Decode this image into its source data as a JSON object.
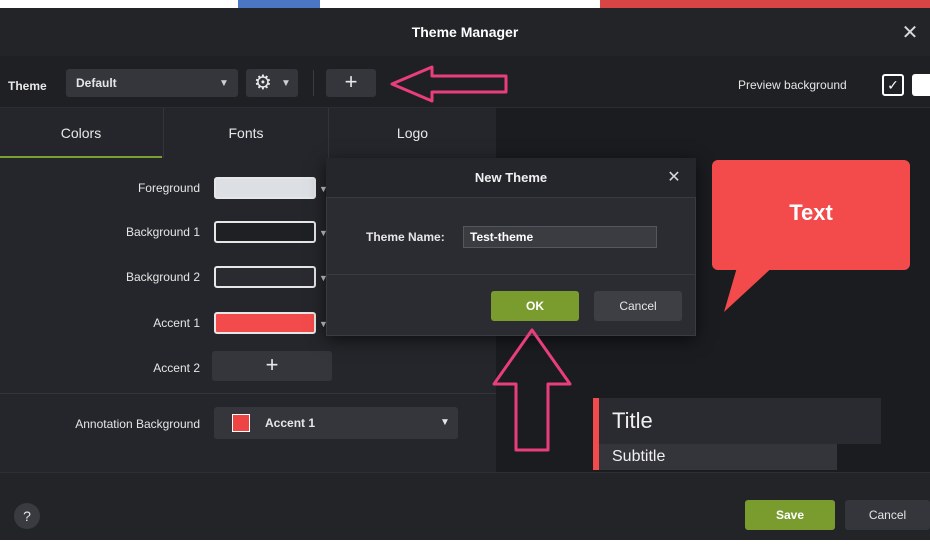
{
  "window": {
    "title": "Theme Manager",
    "close_glyph": "✕"
  },
  "toolbar": {
    "theme_label": "Theme",
    "theme_value": "Default",
    "caret_glyph": "▼",
    "gear_glyph": "⚙",
    "add_glyph": "+",
    "preview_background_label": "Preview background",
    "preview_checked_glyph": "✓"
  },
  "tabs": [
    {
      "label": "Colors",
      "active": true
    },
    {
      "label": "Fonts",
      "active": false
    },
    {
      "label": "Logo",
      "active": false
    }
  ],
  "colors": {
    "rows": [
      {
        "label": "Foreground",
        "color": "#dcdfe4"
      },
      {
        "label": "Background 1",
        "color": "#1f2024"
      },
      {
        "label": "Background 2",
        "color": "#2a2b30"
      },
      {
        "label": "Accent 1",
        "color": "#f34b4b"
      }
    ],
    "accent2_label": "Accent 2",
    "accent2_add_glyph": "+",
    "annotation_background_label": "Annotation Background",
    "annotation_background_value": "Accent 1",
    "annotation_background_color": "#ef4444"
  },
  "preview": {
    "callout_text": "Text",
    "callout_color": "#f34b4b",
    "lower_third_title": "Title",
    "lower_third_subtitle": "Subtitle"
  },
  "dialog": {
    "title": "New Theme",
    "close_glyph": "✕",
    "name_label": "Theme Name:",
    "name_value": "Test-theme",
    "ok_label": "OK",
    "cancel_label": "Cancel"
  },
  "footer": {
    "help_glyph": "?",
    "save_label": "Save",
    "cancel_label": "Cancel",
    "accent_color": "#7a9c2f"
  },
  "annotations": {
    "arrow_color": "#e83e7a"
  }
}
